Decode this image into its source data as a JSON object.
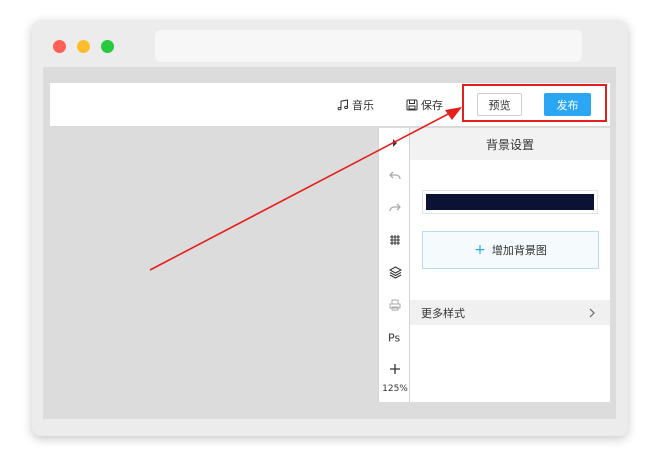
{
  "topbar": {
    "music_label": "音乐",
    "save_label": "保存",
    "preview_label": "预览",
    "publish_label": "发布"
  },
  "toolbar": {
    "zoom": "125%",
    "icons": [
      "expand-arrow-icon",
      "undo-icon",
      "redo-icon",
      "grid-icon",
      "layers-icon",
      "print-icon",
      "ps-icon",
      "add-icon"
    ]
  },
  "panel": {
    "title": "背景设置",
    "background_color": "#0b1233",
    "add_bg_label": "增加背景图",
    "more_styles_label": "更多样式"
  },
  "colors": {
    "accent": "#2aa6f2",
    "highlight": "#e4201c",
    "canvas": "#dcdcdc"
  }
}
